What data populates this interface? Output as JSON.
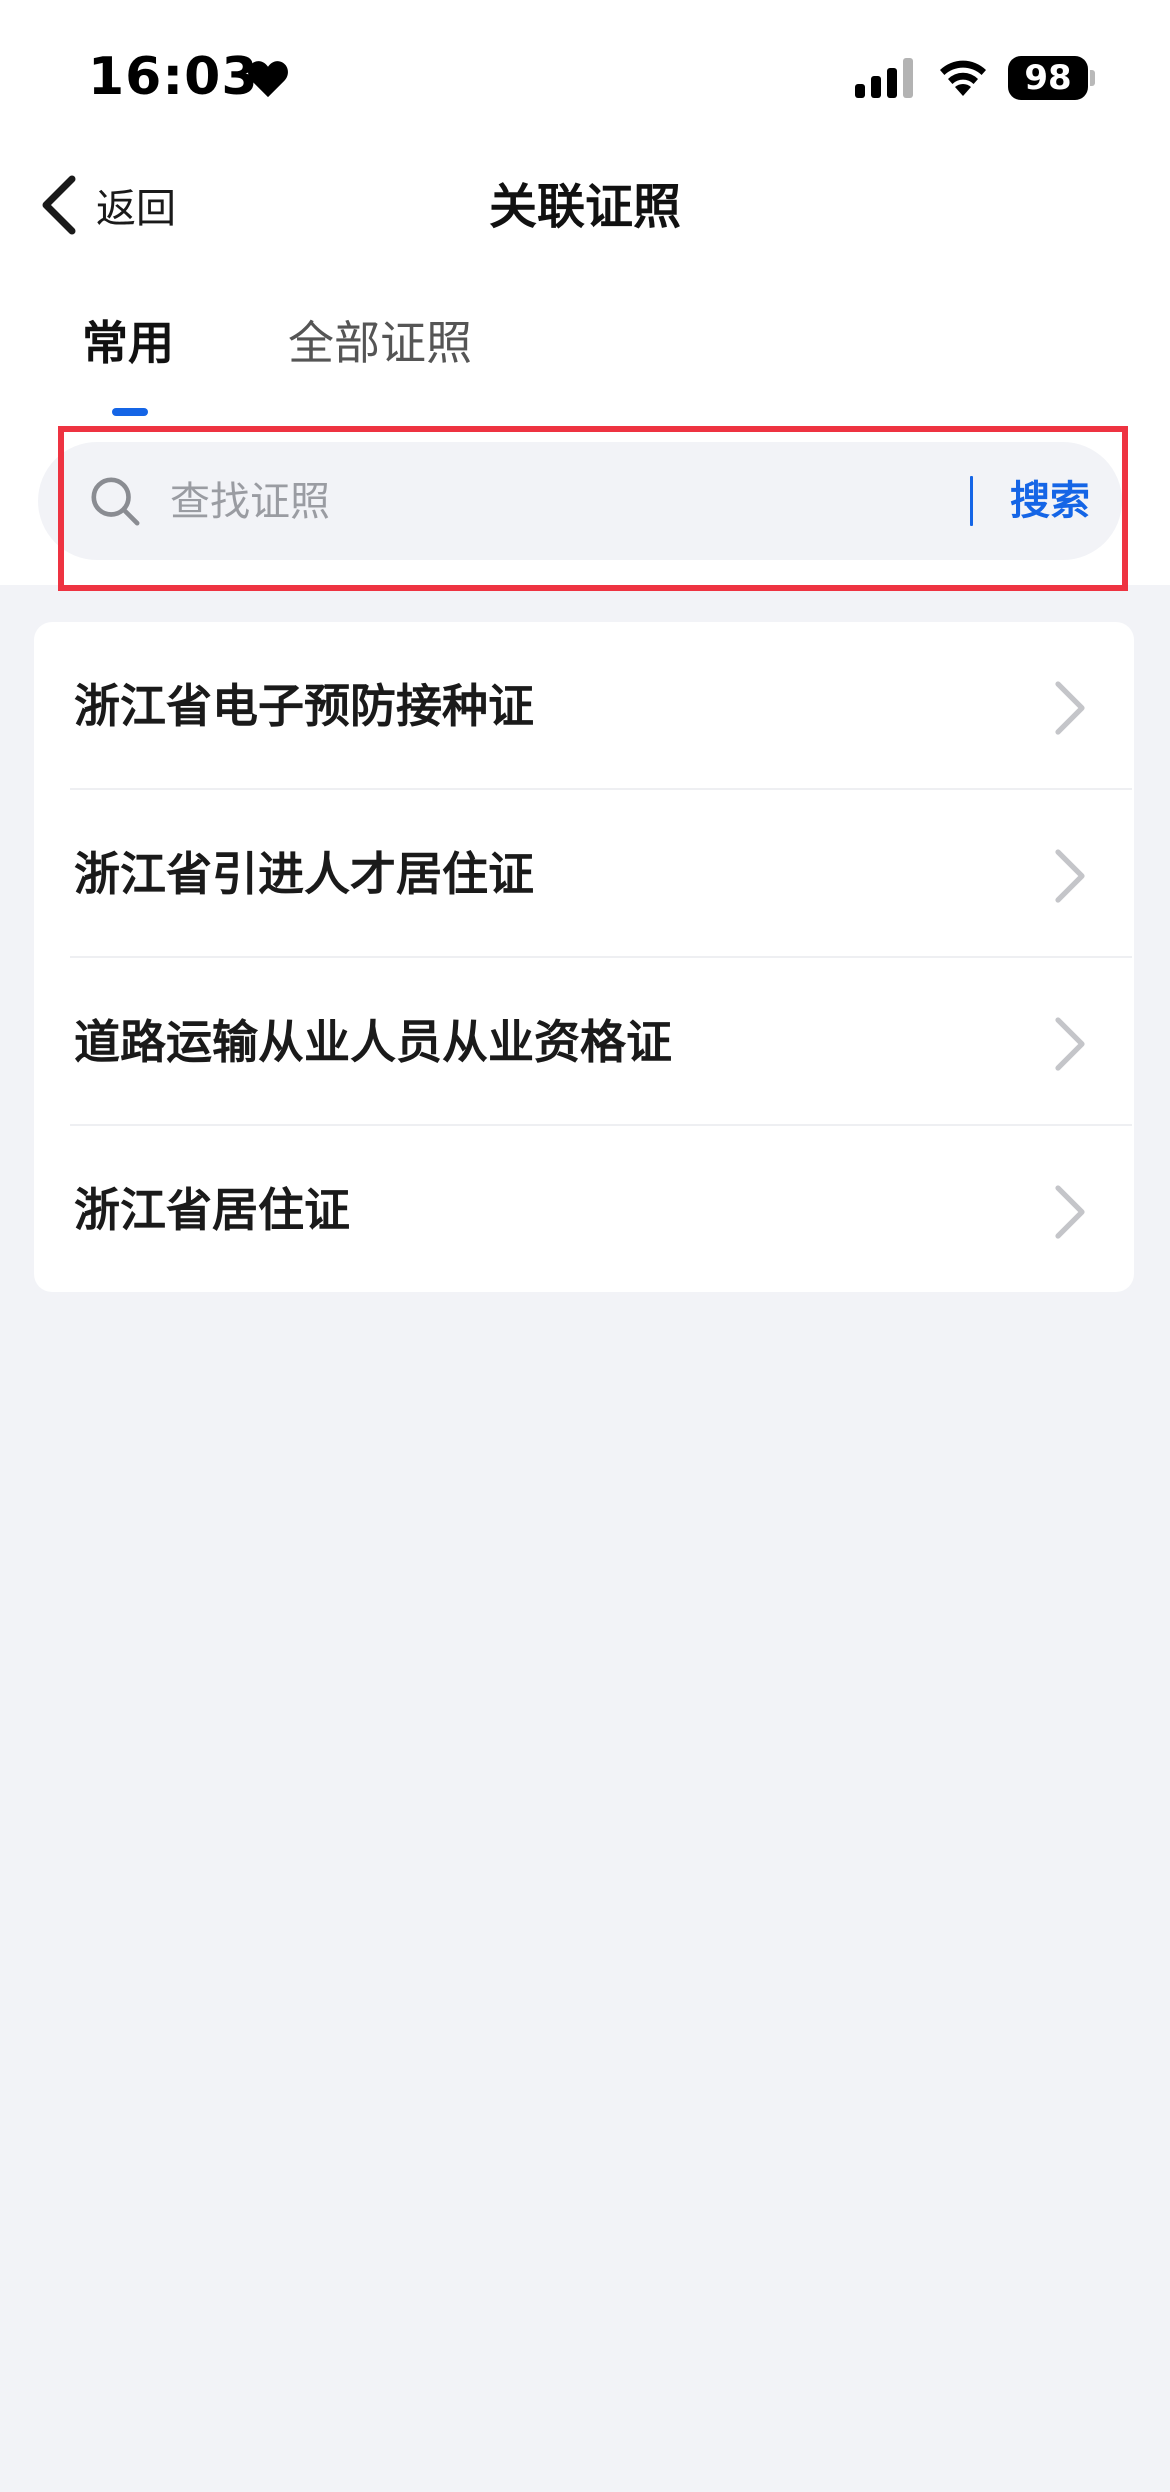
{
  "status_bar": {
    "time": "16:03",
    "battery": "98",
    "icons": [
      "heart-icon",
      "cellular-signal-icon",
      "wifi-icon",
      "battery-icon"
    ]
  },
  "nav": {
    "back_label": "返回",
    "title": "关联证照"
  },
  "tabs": [
    {
      "label": "常用",
      "active": true
    },
    {
      "label": "全部证照",
      "active": false
    }
  ],
  "search": {
    "placeholder": "查找证照",
    "value": "",
    "button_label": "搜索"
  },
  "certificates": [
    {
      "label": "浙江省电子预防接种证"
    },
    {
      "label": "浙江省引进人才居住证"
    },
    {
      "label": "道路运输从业人员从业资格证"
    },
    {
      "label": "浙江省居住证"
    }
  ],
  "colors": {
    "accent": "#1565e6",
    "highlight_frame": "#ee3341",
    "page_background": "#f2f3f7",
    "card_background": "#ffffff"
  }
}
